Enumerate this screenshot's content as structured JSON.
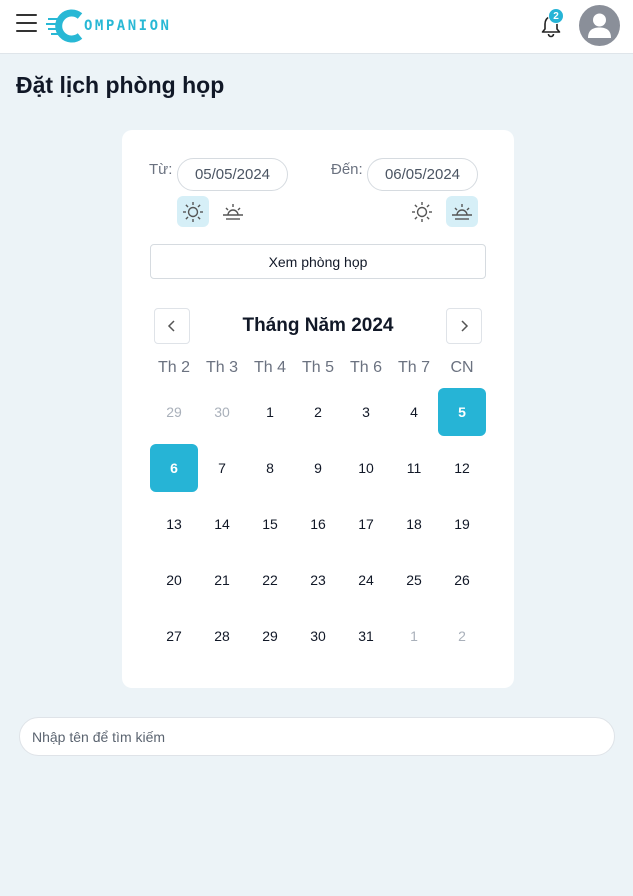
{
  "header": {
    "logo_text": "OMPANION",
    "notification_count": "2",
    "accent": "#26b4d6"
  },
  "page": {
    "title": "Đặt lịch phòng họp"
  },
  "booking": {
    "from_label": "Từ:",
    "from_date": "05/05/2024",
    "to_label": "Đến:",
    "to_date": "06/05/2024",
    "from_active_period": "sun-icon",
    "to_active_period": "sunset-icon",
    "view_button": "Xem phòng họp"
  },
  "calendar": {
    "month_title": "Tháng Năm 2024",
    "weekdays": [
      "Th 2",
      "Th 3",
      "Th 4",
      "Th 5",
      "Th 6",
      "Th 7",
      "CN"
    ],
    "weeks": [
      [
        {
          "d": "29",
          "m": true
        },
        {
          "d": "30",
          "m": true
        },
        {
          "d": "1"
        },
        {
          "d": "2"
        },
        {
          "d": "3"
        },
        {
          "d": "4"
        },
        {
          "d": "5",
          "s": true
        }
      ],
      [
        {
          "d": "6",
          "s": true
        },
        {
          "d": "7"
        },
        {
          "d": "8"
        },
        {
          "d": "9"
        },
        {
          "d": "10"
        },
        {
          "d": "11"
        },
        {
          "d": "12"
        }
      ],
      [
        {
          "d": "13"
        },
        {
          "d": "14"
        },
        {
          "d": "15"
        },
        {
          "d": "16"
        },
        {
          "d": "17"
        },
        {
          "d": "18"
        },
        {
          "d": "19"
        }
      ],
      [
        {
          "d": "20"
        },
        {
          "d": "21"
        },
        {
          "d": "22"
        },
        {
          "d": "23"
        },
        {
          "d": "24"
        },
        {
          "d": "25"
        },
        {
          "d": "26"
        }
      ],
      [
        {
          "d": "27"
        },
        {
          "d": "28"
        },
        {
          "d": "29"
        },
        {
          "d": "30"
        },
        {
          "d": "31"
        },
        {
          "d": "1",
          "m": true
        },
        {
          "d": "2",
          "m": true
        }
      ]
    ]
  },
  "search": {
    "placeholder": "Nhập tên để tìm kiếm"
  }
}
